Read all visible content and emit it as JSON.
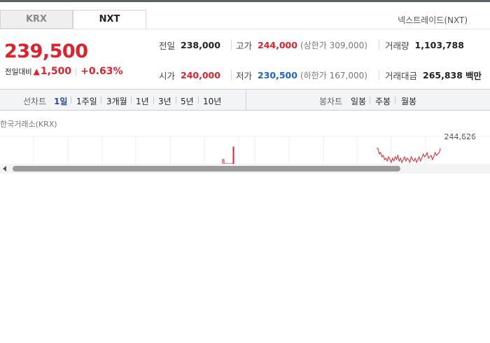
{
  "tabs": [
    {
      "label": "KRX",
      "active": false
    },
    {
      "label": "NXT",
      "active": true
    }
  ],
  "exchange_label": "넥스트레이드(NXT)",
  "price": {
    "current": "239,500",
    "change_label": "전일대비",
    "change_amount": "1,500",
    "change_percent": "+0.63%",
    "color_up": "#e0212b"
  },
  "stats": {
    "prev_close": {
      "label": "전일",
      "value": "238,000"
    },
    "high": {
      "label": "고가",
      "value": "244,000",
      "sub_label": "(상한가",
      "sub_value": "309,000)"
    },
    "volume": {
      "label": "거래량",
      "value": "1,103,788"
    },
    "open": {
      "label": "시가",
      "value": "240,000"
    },
    "low": {
      "label": "저가",
      "value": "230,500",
      "sub_label": "(하한가",
      "sub_value": "167,000)"
    },
    "amount": {
      "label": "거래대금",
      "value": "265,838",
      "unit": "백만"
    }
  },
  "line_chart_periods": {
    "title": "선차트",
    "items": [
      "1일",
      "1주일",
      "3개월",
      "1년",
      "3년",
      "5년",
      "10년"
    ],
    "active": "1일"
  },
  "candle_chart_periods": {
    "title": "봉차트",
    "items": [
      "일봉",
      "주봉",
      "월봉"
    ]
  },
  "chart": {
    "caption": "한국거래소(KRX)",
    "y_max_label": "244,626",
    "line_color": "#e0212b"
  }
}
